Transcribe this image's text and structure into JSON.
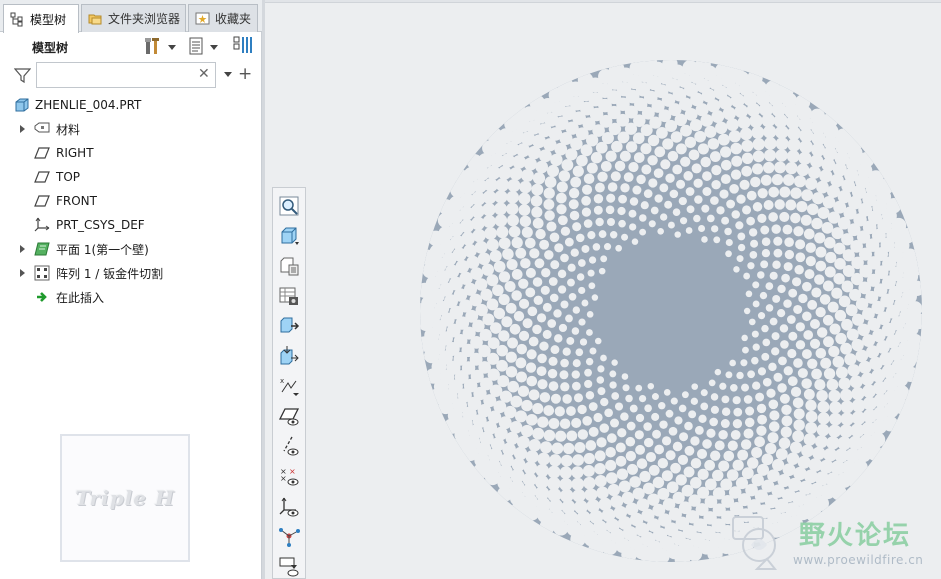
{
  "tabs": [
    {
      "label": "模型树",
      "icon": "model-tree-icon",
      "active": true
    },
    {
      "label": "文件夹浏览器",
      "icon": "folder-browser-icon",
      "active": false
    },
    {
      "label": "收藏夹",
      "icon": "favorites-icon",
      "active": false
    }
  ],
  "tree_header": {
    "title": "模型树"
  },
  "search": {
    "value": "",
    "placeholder": ""
  },
  "tree": [
    {
      "label": "ZHENLIE_004.PRT",
      "icon": "part-icon",
      "expandable": false
    },
    {
      "label": "材料",
      "icon": "material-icon",
      "expandable": true
    },
    {
      "label": "RIGHT",
      "icon": "datum-plane-icon",
      "expandable": false
    },
    {
      "label": "TOP",
      "icon": "datum-plane-icon",
      "expandable": false
    },
    {
      "label": "FRONT",
      "icon": "datum-plane-icon",
      "expandable": false
    },
    {
      "label": "PRT_CSYS_DEF",
      "icon": "coordinate-system-icon",
      "expandable": false
    },
    {
      "label": "平面 1(第一个壁)",
      "icon": "sheetmetal-wall-icon",
      "expandable": true
    },
    {
      "label": "阵列 1 / 钣金件切割",
      "icon": "pattern-icon",
      "expandable": true
    },
    {
      "label": "在此插入",
      "icon": "insert-here-icon",
      "expandable": false
    }
  ],
  "left_watermark": "Triple H",
  "forum": {
    "name": "野火论坛",
    "url": "www.proewildfire.cn"
  },
  "colors": {
    "part_fill": "#9aa8b8",
    "background": "#eceef0",
    "hole": "#eceef0",
    "forum_green": "#8fd0a6"
  },
  "toolbar_buttons": [
    "refit-icon",
    "saved-orientations-icon",
    "view-manager-icon",
    "display-style-icon",
    "reorient-icon",
    "spin-center-icon",
    "annotation-display-icon",
    "plane-display-icon",
    "axis-display-icon",
    "point-display-icon",
    "csys-display-icon",
    "spin-display-icon",
    "more-display-icon"
  ]
}
